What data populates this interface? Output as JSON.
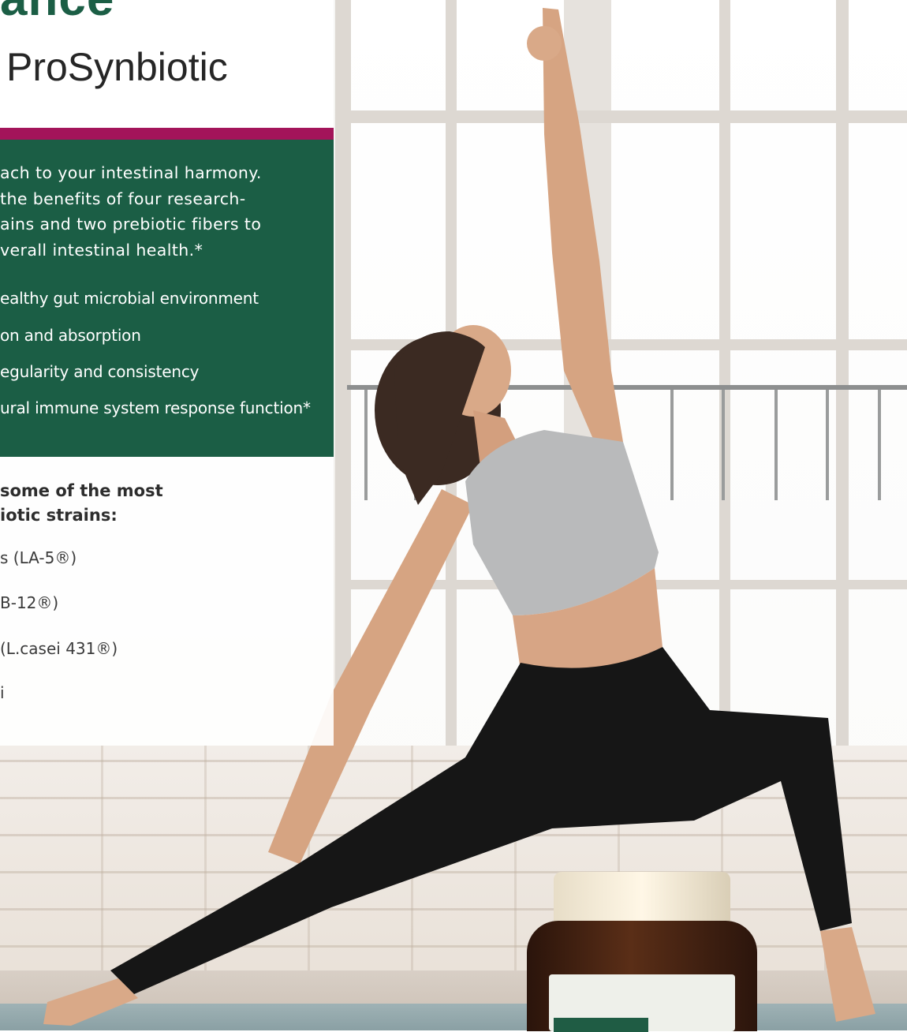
{
  "header": {
    "brand_fragment": "ance",
    "product_name": "ProSynbiotic"
  },
  "intro_lines": [
    "ach to your intestinal harmony.",
    "the benefits of four research-",
    "ains and two prebiotic fibers to",
    "verall intestinal health.*"
  ],
  "benefits": [
    "ealthy gut microbial environment",
    "on and absorption",
    "egularity and consistency",
    "ural immune system response function*"
  ],
  "strains_heading": [
    "some of the most",
    "iotic strains:"
  ],
  "strains": [
    "s (LA-5®)",
    "B-12®)",
    "(L.casei 431®)",
    "i"
  ],
  "colors": {
    "brand_green": "#1b5e45",
    "accent_magenta": "#a3145a",
    "white": "#ffffff"
  }
}
